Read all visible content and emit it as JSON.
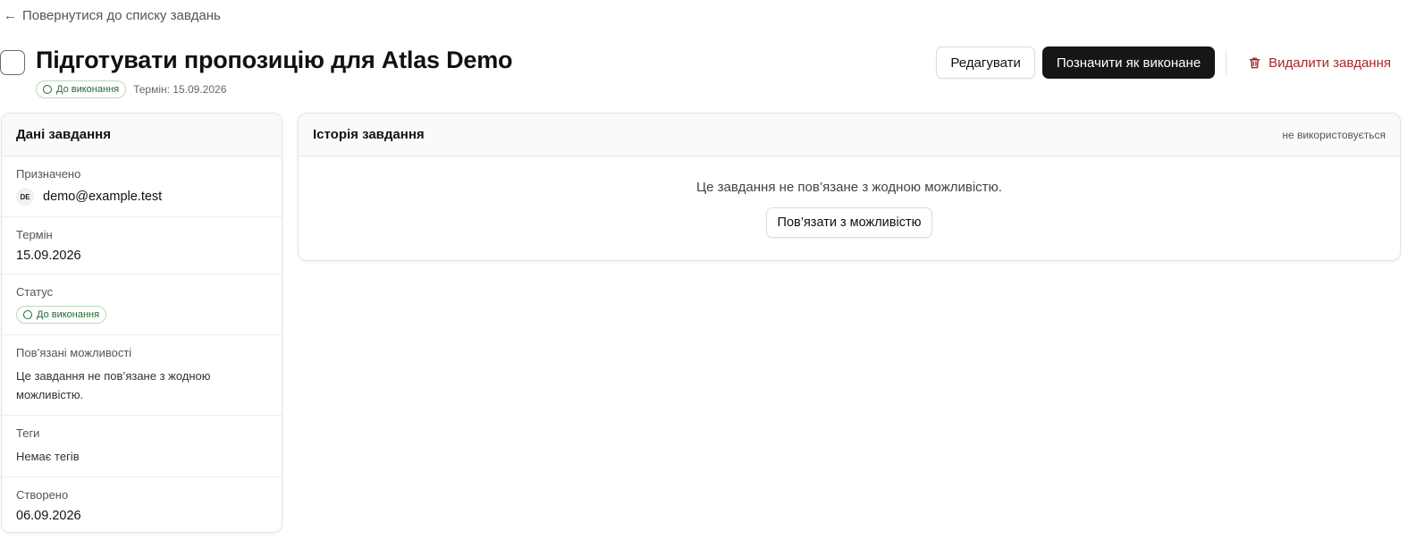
{
  "nav": {
    "back_label": "Повернутися до списку завдань"
  },
  "task": {
    "title": "Підготувати пропозицію для Atlas Demo",
    "status_label": "До виконання",
    "due_meta": "Термін: 15.09.2026"
  },
  "actions": {
    "edit_label": "Редагувати",
    "complete_label": "Позначити як виконане",
    "delete_label": "Видалити завдання"
  },
  "details": {
    "title": "Дані завдання",
    "assigned_label": "Призначено",
    "assignee_initials": "DE",
    "assignee_email": "demo@example.test",
    "due_label": "Термін",
    "due_value": "15.09.2026",
    "status_label": "Статус",
    "status_value": "До виконання",
    "opportunities_label": "Пов’язані можливості",
    "opportunities_value": "Це завдання не пов’язане з жодною можливістю.",
    "tags_label": "Теги",
    "tags_value": "Немає тегів",
    "created_label": "Створено",
    "created_value": "06.09.2026"
  },
  "history": {
    "title": "Історія завдання",
    "note": "не використовується",
    "empty_text": "Це завдання не пов’язане з жодною можливістю.",
    "link_label": "Пов’язати з можливістю"
  },
  "colors": {
    "status_green": "#1f6b2e",
    "danger_red": "#a3282e",
    "primary_dark": "#161616"
  }
}
